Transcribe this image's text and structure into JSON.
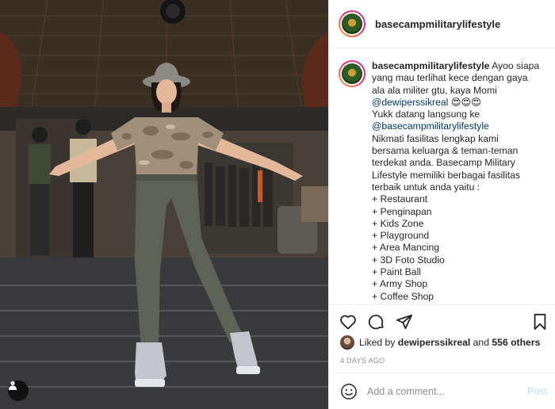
{
  "post": {
    "username": "basecampmilitarylifestyle",
    "caption_lines": [
      [
        "Ayoo siapa"
      ],
      [
        "yang mau terlihat kece dengan gaya"
      ],
      [
        "ala ala militer gtu, kaya Momi"
      ],
      [
        "@dewiperssikreal",
        " 😍😍😍"
      ],
      [
        "Yukk datang langsung ke"
      ],
      [
        "@basecampmilitarylifestyle"
      ],
      [
        "Nikmati fasilitas lengkap kami"
      ],
      [
        "bersama keluarga & teman-teman"
      ],
      [
        "terdekat anda. Basecamp Military"
      ],
      [
        "Lifestyle memiliki berbagai fasilitas"
      ],
      [
        "terbaik untuk anda yaitu :"
      ],
      [
        "+ Restaurant"
      ],
      [
        "+ Penginapan"
      ],
      [
        "+ Kids Zone"
      ],
      [
        "+ Playground"
      ],
      [
        "+ Area Mancing"
      ],
      [
        "+ 3D Foto Studio"
      ],
      [
        "+ Paint Ball"
      ],
      [
        "+ Army Shop"
      ],
      [
        "+ Coffee Shop"
      ]
    ],
    "liked_prefix": "Liked by",
    "liked_user": "dewiperssikreal",
    "liked_and": "and",
    "liked_count": "556 others",
    "timestamp": "4 days ago",
    "comment_placeholder": "Add a comment...",
    "post_label": "Post"
  },
  "icons": {
    "like": "heart-icon",
    "comment": "comment-icon",
    "share": "paper-plane-icon",
    "save": "bookmark-icon",
    "emoji": "smiley-icon",
    "user_tag": "person-icon"
  },
  "colors": {
    "link": "#00376b",
    "post_button_disabled": "#b2dffc",
    "secondary_text": "#8e8e8e"
  }
}
